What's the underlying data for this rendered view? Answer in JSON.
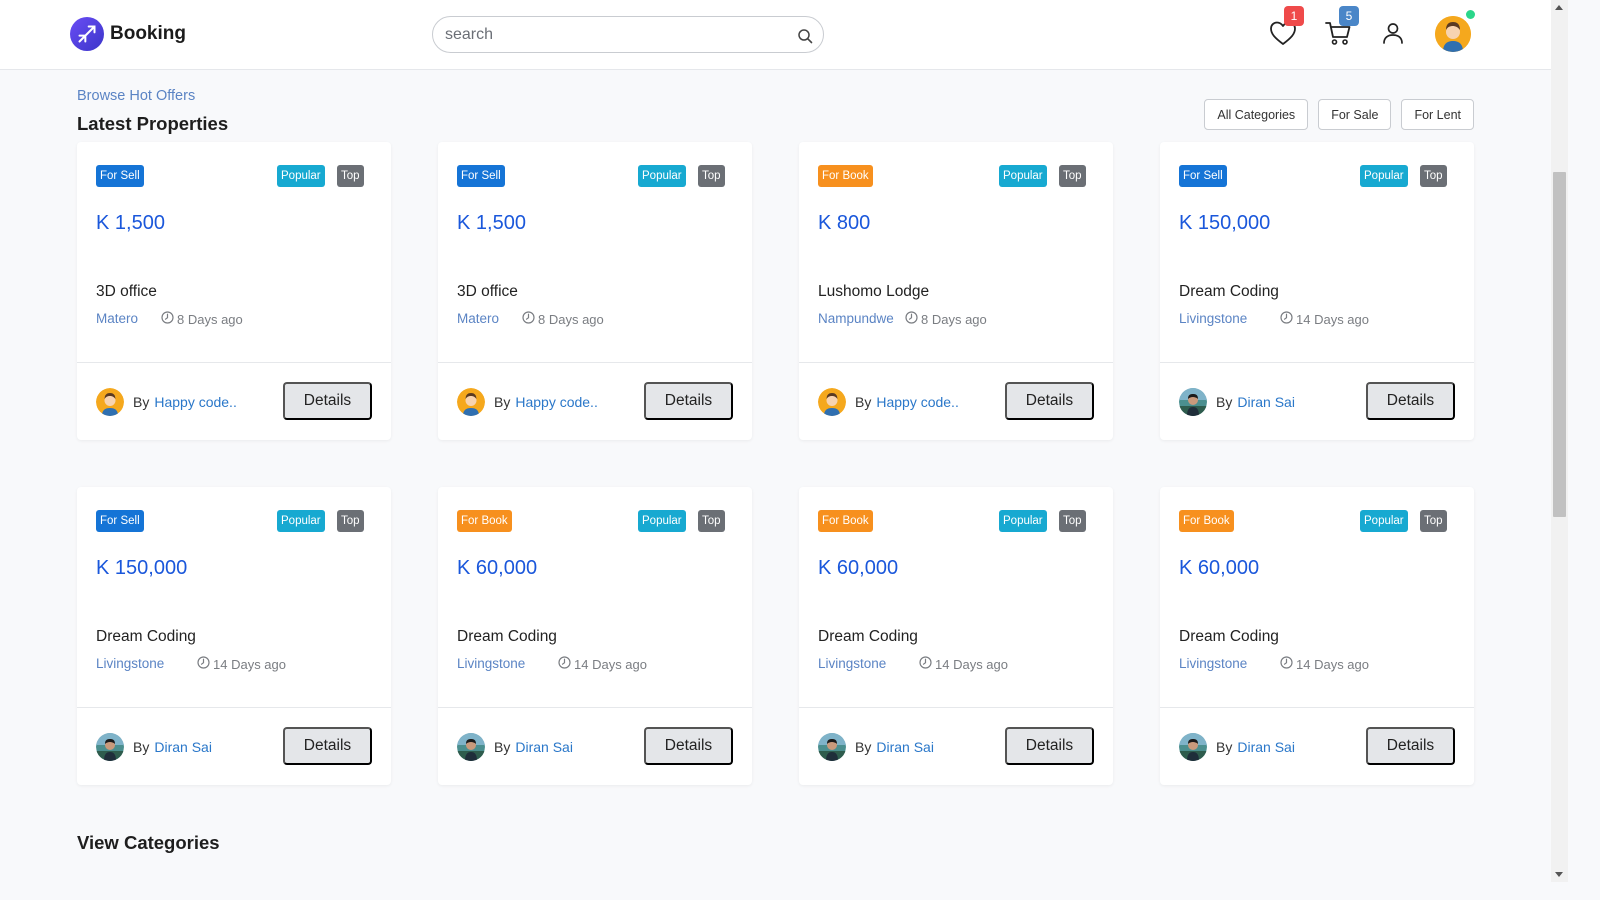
{
  "header": {
    "brand": "Booking",
    "search_placeholder": "search",
    "favorites_count": "1",
    "cart_count": "5"
  },
  "section": {
    "subtitle": "Browse Hot Offers",
    "title": "Latest Properties",
    "filters": [
      "All Categories",
      "For Sale",
      "For Lent"
    ]
  },
  "cards": [
    {
      "status": "For Sell",
      "status_kind": "sell",
      "popular": "Popular",
      "top": "Top",
      "price": "K 1,500",
      "title": "3D office",
      "location": "Matero",
      "time": "8 Days ago",
      "by": "By",
      "owner": "Happy code..",
      "owner_avatar": "orange",
      "details": "Details"
    },
    {
      "status": "For Sell",
      "status_kind": "sell",
      "popular": "Popular",
      "top": "Top",
      "price": "K 1,500",
      "title": "3D office",
      "location": "Matero",
      "time": "8 Days ago",
      "by": "By",
      "owner": "Happy code..",
      "owner_avatar": "orange",
      "details": "Details"
    },
    {
      "status": "For Book",
      "status_kind": "book",
      "popular": "Popular",
      "top": "Top",
      "price": "K 800",
      "title": "Lushomo Lodge",
      "location": "Nampundwe",
      "time": "8 Days ago",
      "by": "By",
      "owner": "Happy code..",
      "owner_avatar": "orange",
      "details": "Details"
    },
    {
      "status": "For Sell",
      "status_kind": "sell",
      "popular": "Popular",
      "top": "Top",
      "price": "K 150,000",
      "title": "Dream Coding",
      "location": "Livingstone",
      "time": "14 Days ago",
      "by": "By",
      "owner": "Diran Sai",
      "owner_avatar": "photo",
      "details": "Details"
    },
    {
      "status": "For Sell",
      "status_kind": "sell",
      "popular": "Popular",
      "top": "Top",
      "price": "K 150,000",
      "title": "Dream Coding",
      "location": "Livingstone",
      "time": "14 Days ago",
      "by": "By",
      "owner": "Diran Sai",
      "owner_avatar": "photo",
      "details": "Details"
    },
    {
      "status": "For Book",
      "status_kind": "book",
      "popular": "Popular",
      "top": "Top",
      "price": "K 60,000",
      "title": "Dream Coding",
      "location": "Livingstone",
      "time": "14 Days ago",
      "by": "By",
      "owner": "Diran Sai",
      "owner_avatar": "photo",
      "details": "Details"
    },
    {
      "status": "For Book",
      "status_kind": "book",
      "popular": "Popular",
      "top": "Top",
      "price": "K 60,000",
      "title": "Dream Coding",
      "location": "Livingstone",
      "time": "14 Days ago",
      "by": "By",
      "owner": "Diran Sai",
      "owner_avatar": "photo",
      "details": "Details"
    },
    {
      "status": "For Book",
      "status_kind": "book",
      "popular": "Popular",
      "top": "Top",
      "price": "K 60,000",
      "title": "Dream Coding",
      "location": "Livingstone",
      "time": "14 Days ago",
      "by": "By",
      "owner": "Diran Sai",
      "owner_avatar": "photo",
      "details": "Details"
    }
  ],
  "footer_section": {
    "title": "View Categories"
  },
  "colors": {
    "accent": "#1a57db",
    "brand": "#4f3fe0",
    "for_sell": "#1574d6",
    "for_book": "#f7901e",
    "popular": "#17a9d1",
    "top": "#6b6f75"
  },
  "icons": [
    "plane-logo-icon",
    "search-icon",
    "heart-icon",
    "cart-icon",
    "user-icon",
    "clock-icon"
  ]
}
